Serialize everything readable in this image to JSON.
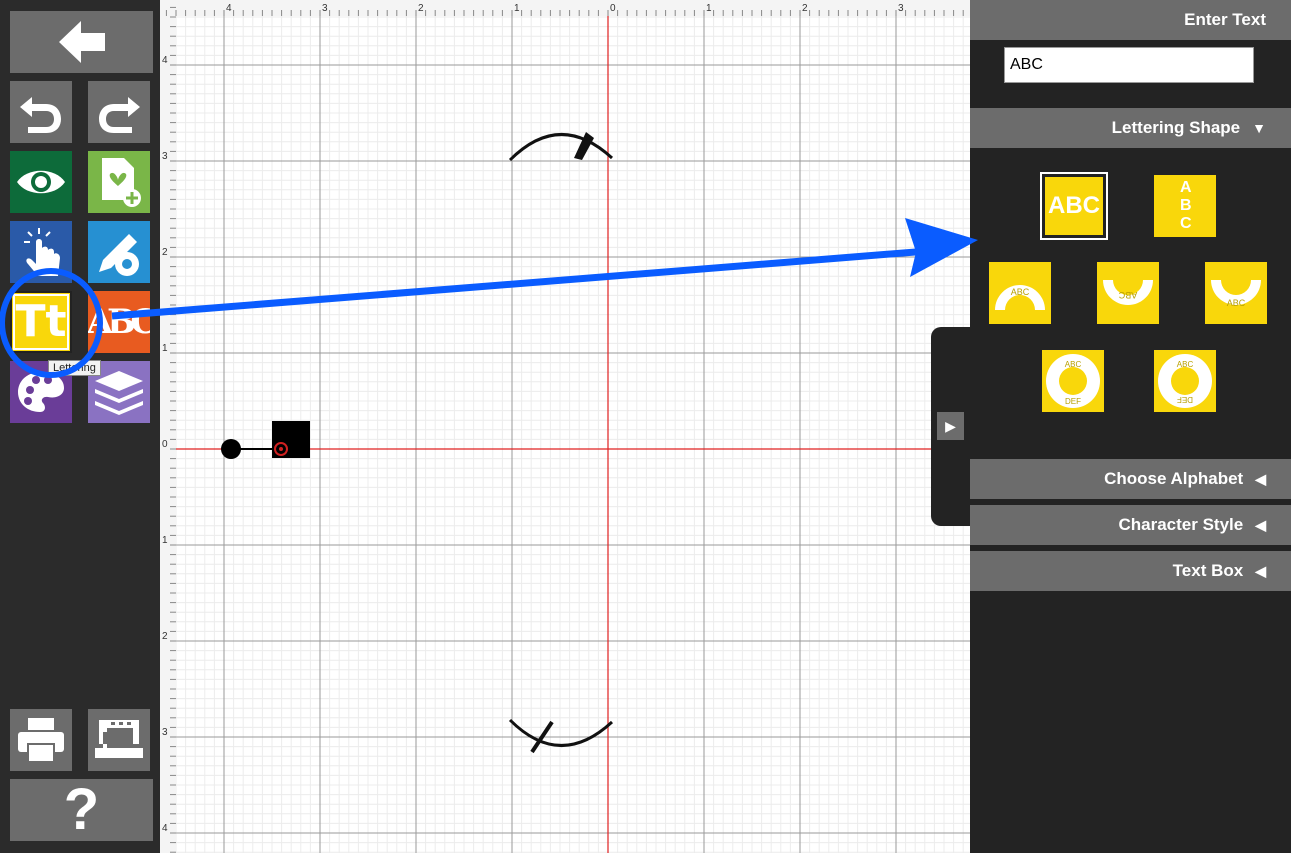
{
  "toolbar": {
    "back": "back-arrow-icon",
    "undo": "undo-icon",
    "redo": "redo-icon",
    "view": "eye-icon",
    "add_design": "add-design-icon",
    "select": "touch-hand-icon",
    "edit": "edit-gear-icon",
    "lettering": "lettering-icon",
    "lettering_glyph": "Tt",
    "monogram": "monogram-icon",
    "monogram_glyph": "ABC",
    "color": "palette-icon",
    "layers": "layers-icon",
    "print": "printer-icon",
    "sew": "sewing-machine-icon",
    "help_label": "?",
    "tooltip": "Lettering"
  },
  "ruler": {
    "top_labels": [
      "4",
      "3",
      "2",
      "1",
      "0",
      "1",
      "2",
      "3"
    ],
    "left_labels": [
      "4",
      "3",
      "2",
      "1",
      "0",
      "1",
      "2",
      "3",
      "4"
    ]
  },
  "panel": {
    "enter_text_title": "Enter Text",
    "text_value": "ABC",
    "lettering_shape_title": "Lettering Shape",
    "lettering_shape_arrow": "▼",
    "shapes": [
      {
        "name": "straight-shape",
        "text": "ABC"
      },
      {
        "name": "vertical-shape",
        "text": "ABC"
      },
      {
        "name": "arch-up-shape",
        "text": "ABC"
      },
      {
        "name": "arch-down-shape",
        "text": "ABC"
      },
      {
        "name": "arch-bottom-shape",
        "text": "ABC"
      },
      {
        "name": "circle-shape",
        "text_top": "ABC",
        "text_bottom": "DEF"
      },
      {
        "name": "circle-inverted-shape",
        "text_top": "ABC",
        "text_bottom": "DEF"
      }
    ],
    "choose_alphabet": "Choose Alphabet",
    "character_style": "Character Style",
    "text_box": "Text Box",
    "collapsed_arrow": "◀",
    "panel_toggle": "▶"
  },
  "colors": {
    "accent_yellow": "#f9d70b",
    "annotation_blue": "#0a5cff",
    "axis_red": "#e02020"
  }
}
